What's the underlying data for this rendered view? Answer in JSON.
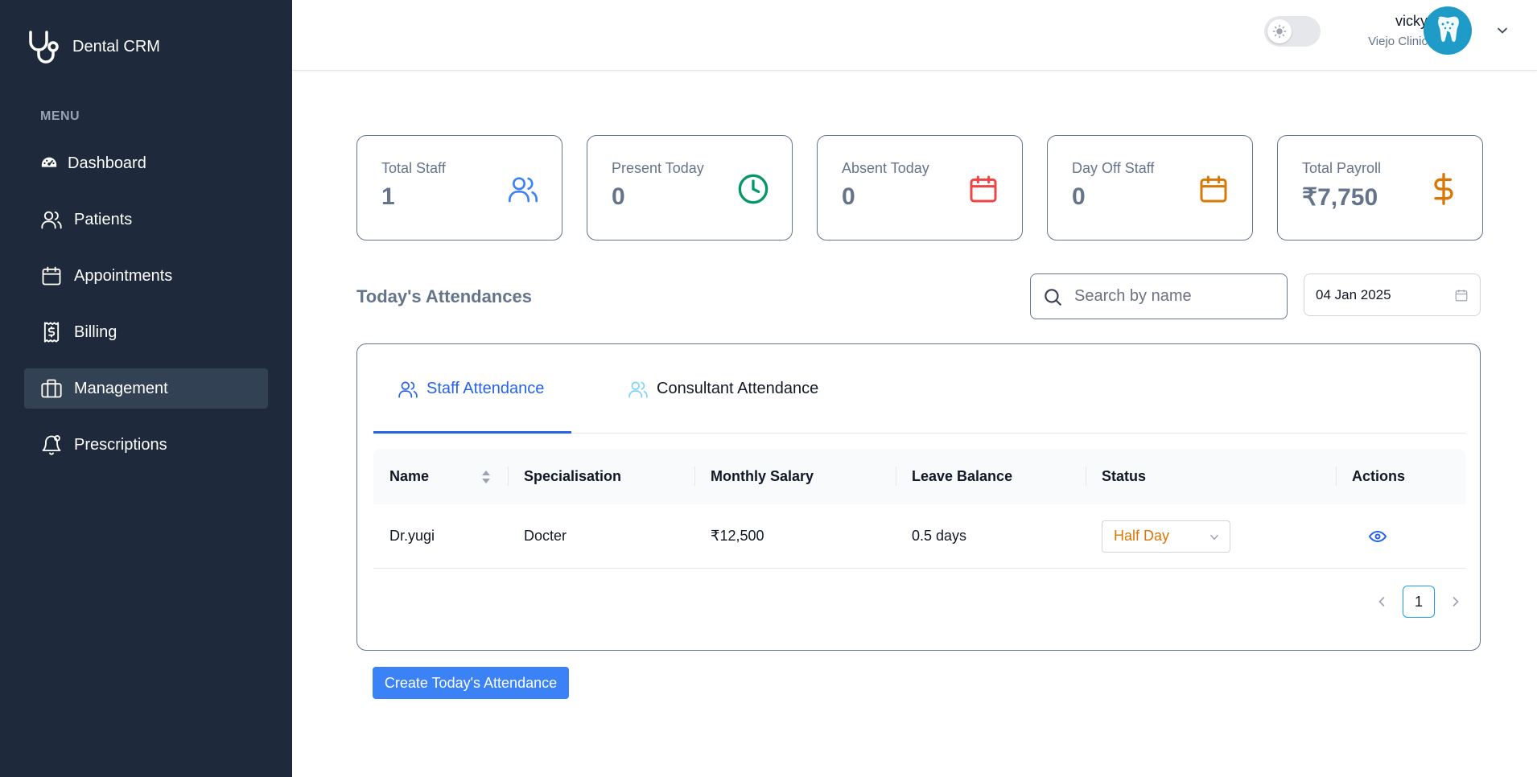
{
  "brand": {
    "name": "Dental CRM"
  },
  "sidebar": {
    "menu_label": "MENU",
    "items": [
      {
        "label": "Dashboard",
        "icon": "dashboard-icon",
        "active": false
      },
      {
        "label": "Patients",
        "icon": "users-icon",
        "active": false
      },
      {
        "label": "Appointments",
        "icon": "calendar-icon",
        "active": false
      },
      {
        "label": "Billing",
        "icon": "receipt-icon",
        "active": false
      },
      {
        "label": "Management",
        "icon": "briefcase-icon",
        "active": true
      },
      {
        "label": "Prescriptions",
        "icon": "bell-icon",
        "active": false
      }
    ]
  },
  "header": {
    "user_name": "vicky",
    "clinic": "Viejo Clinic",
    "theme": "light"
  },
  "stats": [
    {
      "label": "Total Staff",
      "value": "1",
      "icon": "users-icon",
      "color": "#3b82f6"
    },
    {
      "label": "Present Today",
      "value": "0",
      "icon": "clock-icon",
      "color": "#059669"
    },
    {
      "label": "Absent Today",
      "value": "0",
      "icon": "calendar-icon",
      "color": "#ef4444"
    },
    {
      "label": "Day Off Staff",
      "value": "0",
      "icon": "calendar-icon",
      "color": "#d97706"
    },
    {
      "label": "Total Payroll",
      "value": "₹7,750",
      "icon": "dollar-icon",
      "color": "#d97706"
    }
  ],
  "attendance": {
    "title": "Today's Attendances",
    "search_placeholder": "Search by name",
    "date": "04 Jan 2025",
    "tabs": [
      {
        "label": "Staff Attendance",
        "active": true
      },
      {
        "label": "Consultant Attendance",
        "active": false
      }
    ],
    "columns": [
      "Name",
      "Specialisation",
      "Monthly Salary",
      "Leave Balance",
      "Status",
      "Actions"
    ],
    "rows": [
      {
        "name": "Dr.yugi",
        "specialisation": "Docter",
        "salary": "₹12,500",
        "leave": "0.5 days",
        "status": "Half Day"
      }
    ],
    "page": "1",
    "create_label": "Create Today's Attendance"
  },
  "colors": {
    "sidebar_bg": "#1e293b",
    "accent": "#2563eb",
    "button": "#3b82f6"
  }
}
